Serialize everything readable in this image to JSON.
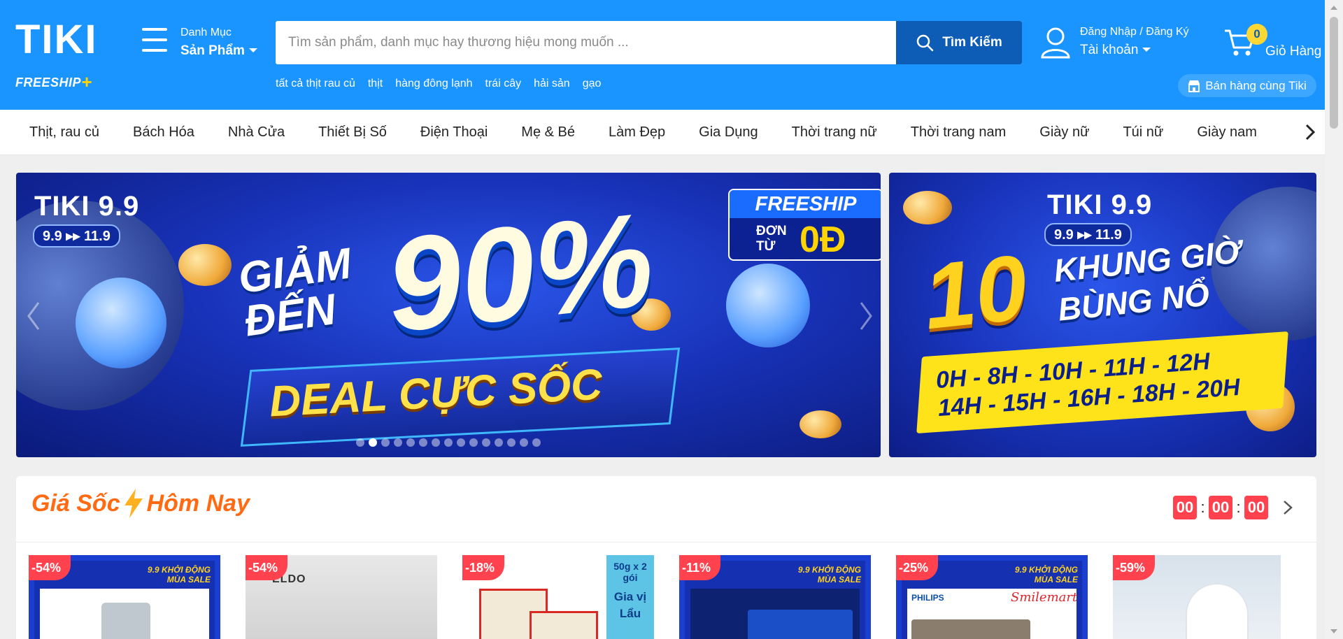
{
  "header": {
    "logo_text": "TIKI",
    "freeship_label": "FREESHIP",
    "category_menu": {
      "small_label": "Danh Mục",
      "big_label": "Sản Phẩm"
    },
    "search": {
      "placeholder": "Tìm sản phẩm, danh mục hay thương hiệu mong muốn ...",
      "value": "",
      "button_label": "Tìm Kiếm"
    },
    "quick_links": [
      "tất cả thịt rau củ",
      "thịt",
      "hàng đông lạnh",
      "trái cây",
      "hải sản",
      "gạo"
    ],
    "account": {
      "small_label": "Đăng Nhập / Đăng Ký",
      "big_label": "Tài khoản"
    },
    "cart": {
      "count": "0",
      "label": "Giỏ Hàng"
    },
    "seller_button": "Bán hàng cùng Tiki",
    "brand_color": "#1a94ff"
  },
  "category_bar": {
    "items": [
      "Thịt, rau củ",
      "Bách Hóa",
      "Nhà Cửa",
      "Thiết Bị Số",
      "Điện Thoại",
      "Mẹ & Bé",
      "Làm Đẹp",
      "Gia Dụng",
      "Thời trang nữ",
      "Thời trang nam",
      "Giày nữ",
      "Túi nữ",
      "Giày nam"
    ],
    "next_icon": "chevron-right-icon"
  },
  "banners": {
    "main": {
      "tiki_label": "TIKI 9.9",
      "date_range": "9.9 ▸▸ 11.9",
      "headline_top": "GIẢM",
      "headline_bottom": "ĐẾN",
      "percent": "90%",
      "deal_text": "DEAL CỰC SỐC",
      "freeship": "FREESHIP",
      "freeship_sub1": "ĐƠN",
      "freeship_sub2": "TỪ",
      "freeship_amount": "0Đ",
      "slide_count": 15,
      "active_slide": 2
    },
    "side": {
      "tiki_label": "TIKI 9.9",
      "date_range": "9.9 ▸▸ 11.9",
      "big_number": "10",
      "line1": "KHUNG GIỜ",
      "line2": "BÙNG NỔ",
      "hours_line1": "0H - 8H - 10H - 11H - 12H",
      "hours_line2": "14H - 15H - 16H - 18H - 20H"
    }
  },
  "flash_sale": {
    "title_left": "Giá Sốc",
    "title_right": "Hôm Nay",
    "countdown": {
      "hours": "00",
      "minutes": "00",
      "seconds": "00"
    },
    "products": [
      {
        "discount": "-54%",
        "sale_tag": "9.9 KHỞI ĐỘNG MÙA SALE"
      },
      {
        "discount": "-54%",
        "brand": "ELDO"
      },
      {
        "discount": "-18%",
        "pack_label": "50g x 2 gói",
        "side_text": "Gia vị Lẩu"
      },
      {
        "discount": "-11%",
        "sale_tag": "9.9 KHỞI ĐỘNG MÙA SALE"
      },
      {
        "discount": "-25%",
        "sale_tag": "9.9 KHỞI ĐỘNG MÙA SALE",
        "brand1": "PHILIPS",
        "brand2": "Smilemart"
      },
      {
        "discount": "-59%"
      }
    ],
    "accent_color": "#ff424e"
  }
}
